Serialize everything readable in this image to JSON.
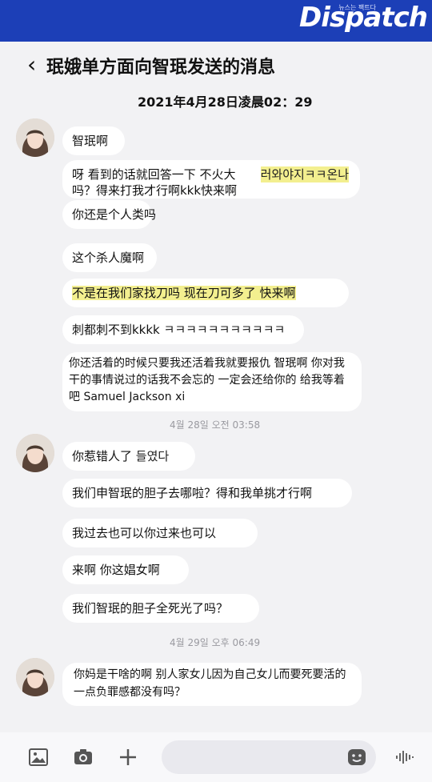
{
  "brand": {
    "name": "Dispatch",
    "tagline": "뉴스는 팩트다"
  },
  "header": {
    "back_glyph": "‹",
    "title": "珉娥单方面向智珉发送的消息"
  },
  "datetime": "2021年4月28日凌晨02：29",
  "messages": [
    {
      "text": "智珉啊"
    },
    {
      "text": "呀 看到的话就回答一下 不火大吗？得来打我才行啊kkk快来啊",
      "ko": "러와야지ㅋㅋ온나"
    },
    {
      "text": "你还是个人类吗"
    },
    {
      "text": "这个杀人魔啊"
    },
    {
      "text": "不是在我们家找刀吗 现在刀可多了 快来啊"
    },
    {
      "text": "刺都刺不到kkkk",
      "ko": "ㅋㅋㅋㅋㅋㅋㅋㅋㅋㅋㅋ"
    },
    {
      "text": "你还活着的时候只要我还活着我就要报仇 智珉啊 你对我干的事情说过的话我不会忘的 一定会还给你的 给我等着吧 Samuel Jackson xi"
    },
    {
      "text": "你惹错人了",
      "ko": "들였다"
    },
    {
      "text": "我们申智珉的胆子去哪啦？得和我单挑才行啊"
    },
    {
      "text": "我过去也可以你过来也可以"
    },
    {
      "text": "来啊 你这娼女啊"
    },
    {
      "text": "我们智珉的胆子全死光了吗？"
    },
    {
      "text": "你妈是干啥的啊 别人家女儿因为自己女儿而要死要活的 一点负罪感都没有吗？"
    }
  ],
  "timestamps": [
    "4월 28일 오전 03:58",
    "4월 29일 오후 06:49"
  ],
  "bottom": {
    "icons": [
      "image-icon",
      "camera-icon",
      "plus-icon",
      "emoji-icon",
      "voice-icon"
    ]
  },
  "colors": {
    "banner": "#1c3fb7",
    "highlight": "#f3ef8f",
    "background": "#f2f2f4"
  }
}
